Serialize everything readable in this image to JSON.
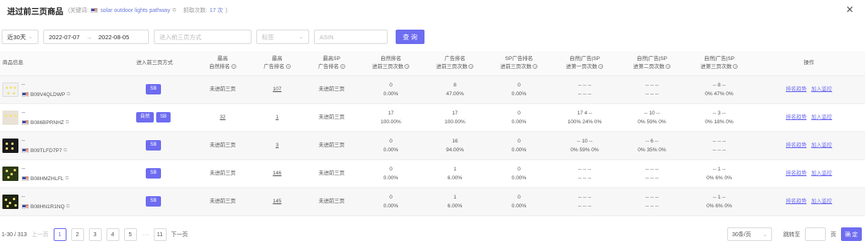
{
  "header": {
    "title": "进过前三页商品",
    "keyword_prefix": "(关键词:",
    "keyword": "solar outdoor lights pathway",
    "crawl_label": "抓取次数:",
    "crawl_count": "17 次",
    "suffix": ")"
  },
  "filters": {
    "range": "近30天",
    "date_start": "2022-07-07",
    "date_arrow": "→",
    "date_end": "2022-08-05",
    "method_placeholder": "进入前三页方式",
    "tag_placeholder": "标签",
    "asin_placeholder": "ASIN",
    "search_label": "查 询"
  },
  "columns": {
    "product": "商品信息",
    "method": "进入前三页方式",
    "c1": [
      "最高",
      "自然排名"
    ],
    "c2": [
      "最高",
      "广告排名"
    ],
    "c3": [
      "最高SP",
      "广告排名"
    ],
    "c4": [
      "自然排名",
      "进前三页次数"
    ],
    "c5": [
      "广告排名",
      "进前三页次数"
    ],
    "c6": [
      "SP广告排名",
      "进前三页次数"
    ],
    "c7": [
      "自然|广告|SP",
      "进第一页次数"
    ],
    "c8": [
      "自然|广告|SP",
      "进第二页次数"
    ],
    "c9": [
      "自然|广告|SP",
      "进第三页次数"
    ],
    "op": "操作"
  },
  "rows": [
    {
      "name": "--",
      "asin": "B09V4QLDWP",
      "tags": [
        "SB"
      ],
      "nat": "未进前三页",
      "ad": "107",
      "sp": "未进前三页",
      "n_top3": "0",
      "n_pct": "0.00%",
      "a_top3": "8",
      "a_pct": "47.00%",
      "s_top3": "0",
      "s_pct": "0.00%",
      "p1a": "-- -- --",
      "p1b": "-- -- --",
      "p2a": "-- -- --",
      "p2b": "-- -- --",
      "p3a": "-- 8 --",
      "p3b": "0% 47% 0%",
      "op1": "排名趋势",
      "op2": "加入监控"
    },
    {
      "name": "--",
      "asin": "B086BPRNHZ",
      "tags": [
        "自然",
        "SB"
      ],
      "nat": "32",
      "ad": "1",
      "sp": "未进前三页",
      "n_top3": "17",
      "n_pct": "100.00%",
      "a_top3": "17",
      "a_pct": "100.00%",
      "s_top3": "0",
      "s_pct": "0.00%",
      "p1a": "17 4 --",
      "p1b": "100% 24% 0%",
      "p2a": "-- 10 --",
      "p2b": "0% 59% 0%",
      "p3a": "-- 3 --",
      "p3b": "0% 18% 0%",
      "op1": "排名趋势",
      "op2": "加入监控"
    },
    {
      "name": "--",
      "asin": "B09TLFD7P7",
      "tags": [
        "SB"
      ],
      "nat": "未进前三页",
      "ad": "3",
      "sp": "未进前三页",
      "n_top3": "0",
      "n_pct": "0.00%",
      "a_top3": "16",
      "a_pct": "94.00%",
      "s_top3": "0",
      "s_pct": "0.00%",
      "p1a": "-- 10 --",
      "p1b": "0% 59% 0%",
      "p2a": "-- 6 --",
      "p2b": "0% 35% 0%",
      "p3a": "-- -- --",
      "p3b": "-- -- --",
      "op1": "排名趋势",
      "op2": "加入监控"
    },
    {
      "name": "--",
      "asin": "B08HMZHLFL",
      "tags": [
        "SB"
      ],
      "nat": "未进前三页",
      "ad": "146",
      "sp": "未进前三页",
      "n_top3": "0",
      "n_pct": "0.00%",
      "a_top3": "1",
      "a_pct": "6.00%",
      "s_top3": "0",
      "s_pct": "0.00%",
      "p1a": "-- -- --",
      "p1b": "-- -- --",
      "p2a": "-- -- --",
      "p2b": "-- -- --",
      "p3a": "-- 1 --",
      "p3b": "0% 6% 0%",
      "op1": "排名趋势",
      "op2": "加入监控"
    },
    {
      "name": "--",
      "asin": "B08HN1R1NQ",
      "tags": [
        "SB"
      ],
      "nat": "未进前三页",
      "ad": "145",
      "sp": "未进前三页",
      "n_top3": "0",
      "n_pct": "0.00%",
      "a_top3": "1",
      "a_pct": "6.00%",
      "s_top3": "0",
      "s_pct": "0.00%",
      "p1a": "-- -- --",
      "p1b": "-- -- --",
      "p2a": "-- -- --",
      "p2b": "-- -- --",
      "p3a": "-- 1 --",
      "p3b": "0% 6% 0%",
      "op1": "排名趋势",
      "op2": "加入监控"
    }
  ],
  "pager": {
    "range": "1-30 / 313",
    "prev": "上一页",
    "pages": [
      "1",
      "2",
      "3",
      "4",
      "5"
    ],
    "ellipsis": "···",
    "last": "11",
    "next": "下一页",
    "per_page": "30条/页",
    "jump_label": "跳转至",
    "page_unit": "页",
    "confirm": "确 定"
  }
}
